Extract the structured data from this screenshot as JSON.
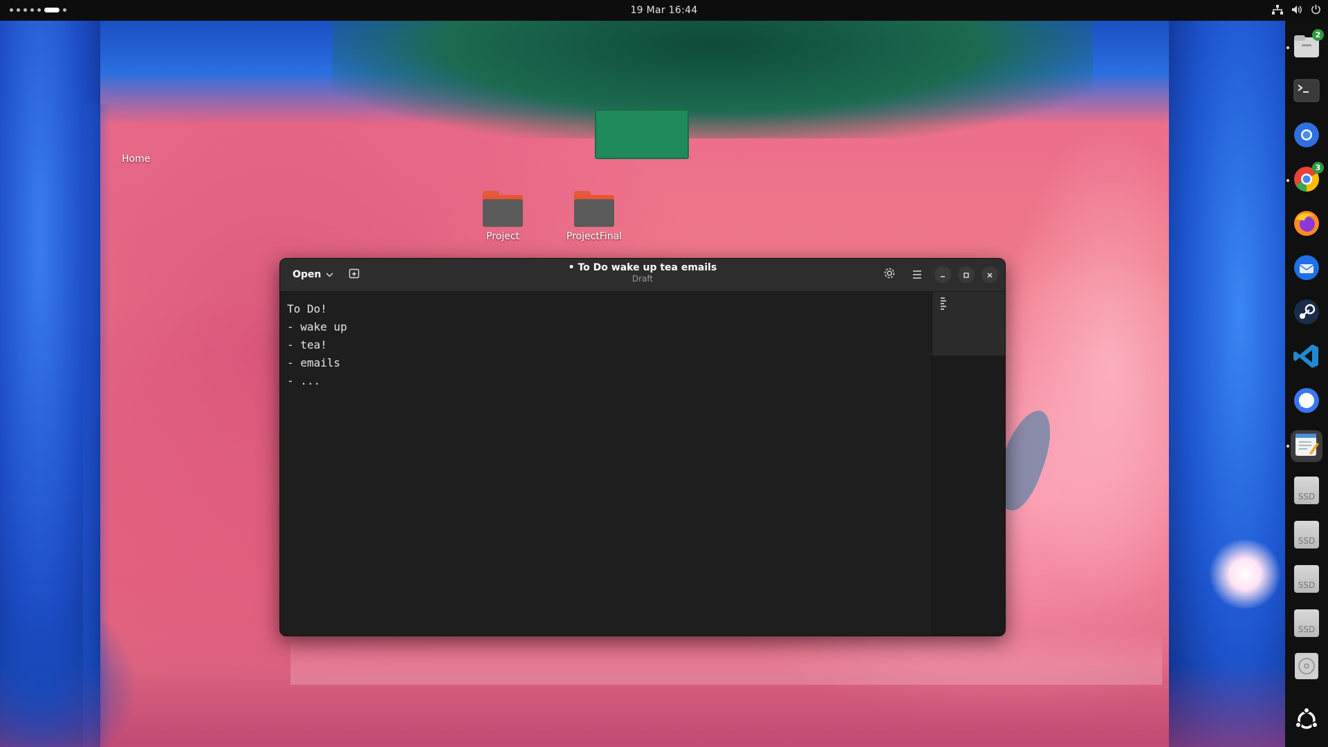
{
  "topbar": {
    "clock": "19 Mar  16:44"
  },
  "desktop": {
    "home_label": "Home",
    "folders": [
      {
        "label": "Project"
      },
      {
        "label": "ProjectFinal"
      }
    ]
  },
  "editor": {
    "open_label": "Open",
    "title": "• To Do wake up tea emails",
    "subtitle": "Draft",
    "content": "To Do!\n- wake up\n- tea!\n- emails\n- ..."
  },
  "dock": {
    "files_badge": "2",
    "chrome_badge": "3",
    "ssd_label": "SSD",
    "items": [
      "files-icon",
      "terminal-icon",
      "chromium-icon",
      "chrome-icon",
      "firefox-icon",
      "thunderbird-icon",
      "steam-icon",
      "vscode-icon",
      "signal-icon",
      "text-editor-icon",
      "ssd-icon",
      "ssd-icon",
      "ssd-icon",
      "ssd-icon",
      "optical-drive-icon",
      "ubuntu-icon"
    ]
  }
}
